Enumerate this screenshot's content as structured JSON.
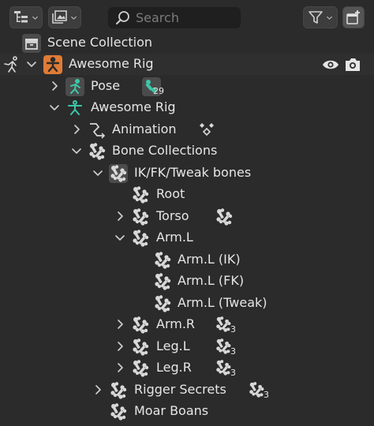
{
  "header": {
    "search_placeholder": "Search"
  },
  "tree": {
    "scene_collection": "Scene Collection",
    "awesome_rig_object": "Awesome Rig",
    "pose": "Pose",
    "pose_count": "29",
    "awesome_rig_armature": "Awesome Rig",
    "animation": "Animation",
    "bone_collections": "Bone Collections",
    "ik_fk_tweak": "IK/FK/Tweak bones",
    "root": "Root",
    "torso": "Torso",
    "arm_l": "Arm.L",
    "arm_l_ik": "Arm.L (IK)",
    "arm_l_fk": "Arm.L (FK)",
    "arm_l_tweak": "Arm.L (Tweak)",
    "arm_r": "Arm.R",
    "arm_r_count": "3",
    "leg_l": "Leg.L",
    "leg_l_count": "3",
    "leg_r": "Leg.R",
    "leg_r_count": "3",
    "rigger_secrets": "Rigger Secrets",
    "rigger_secrets_count": "3",
    "moar_boans": "Moar Boans"
  },
  "colors": {
    "background": "#2b2b2b",
    "object_orange": "#e07b35",
    "armature_green": "#3cc6a7",
    "text": "#e6e6e6",
    "icon_gray": "#d0d0d0"
  }
}
